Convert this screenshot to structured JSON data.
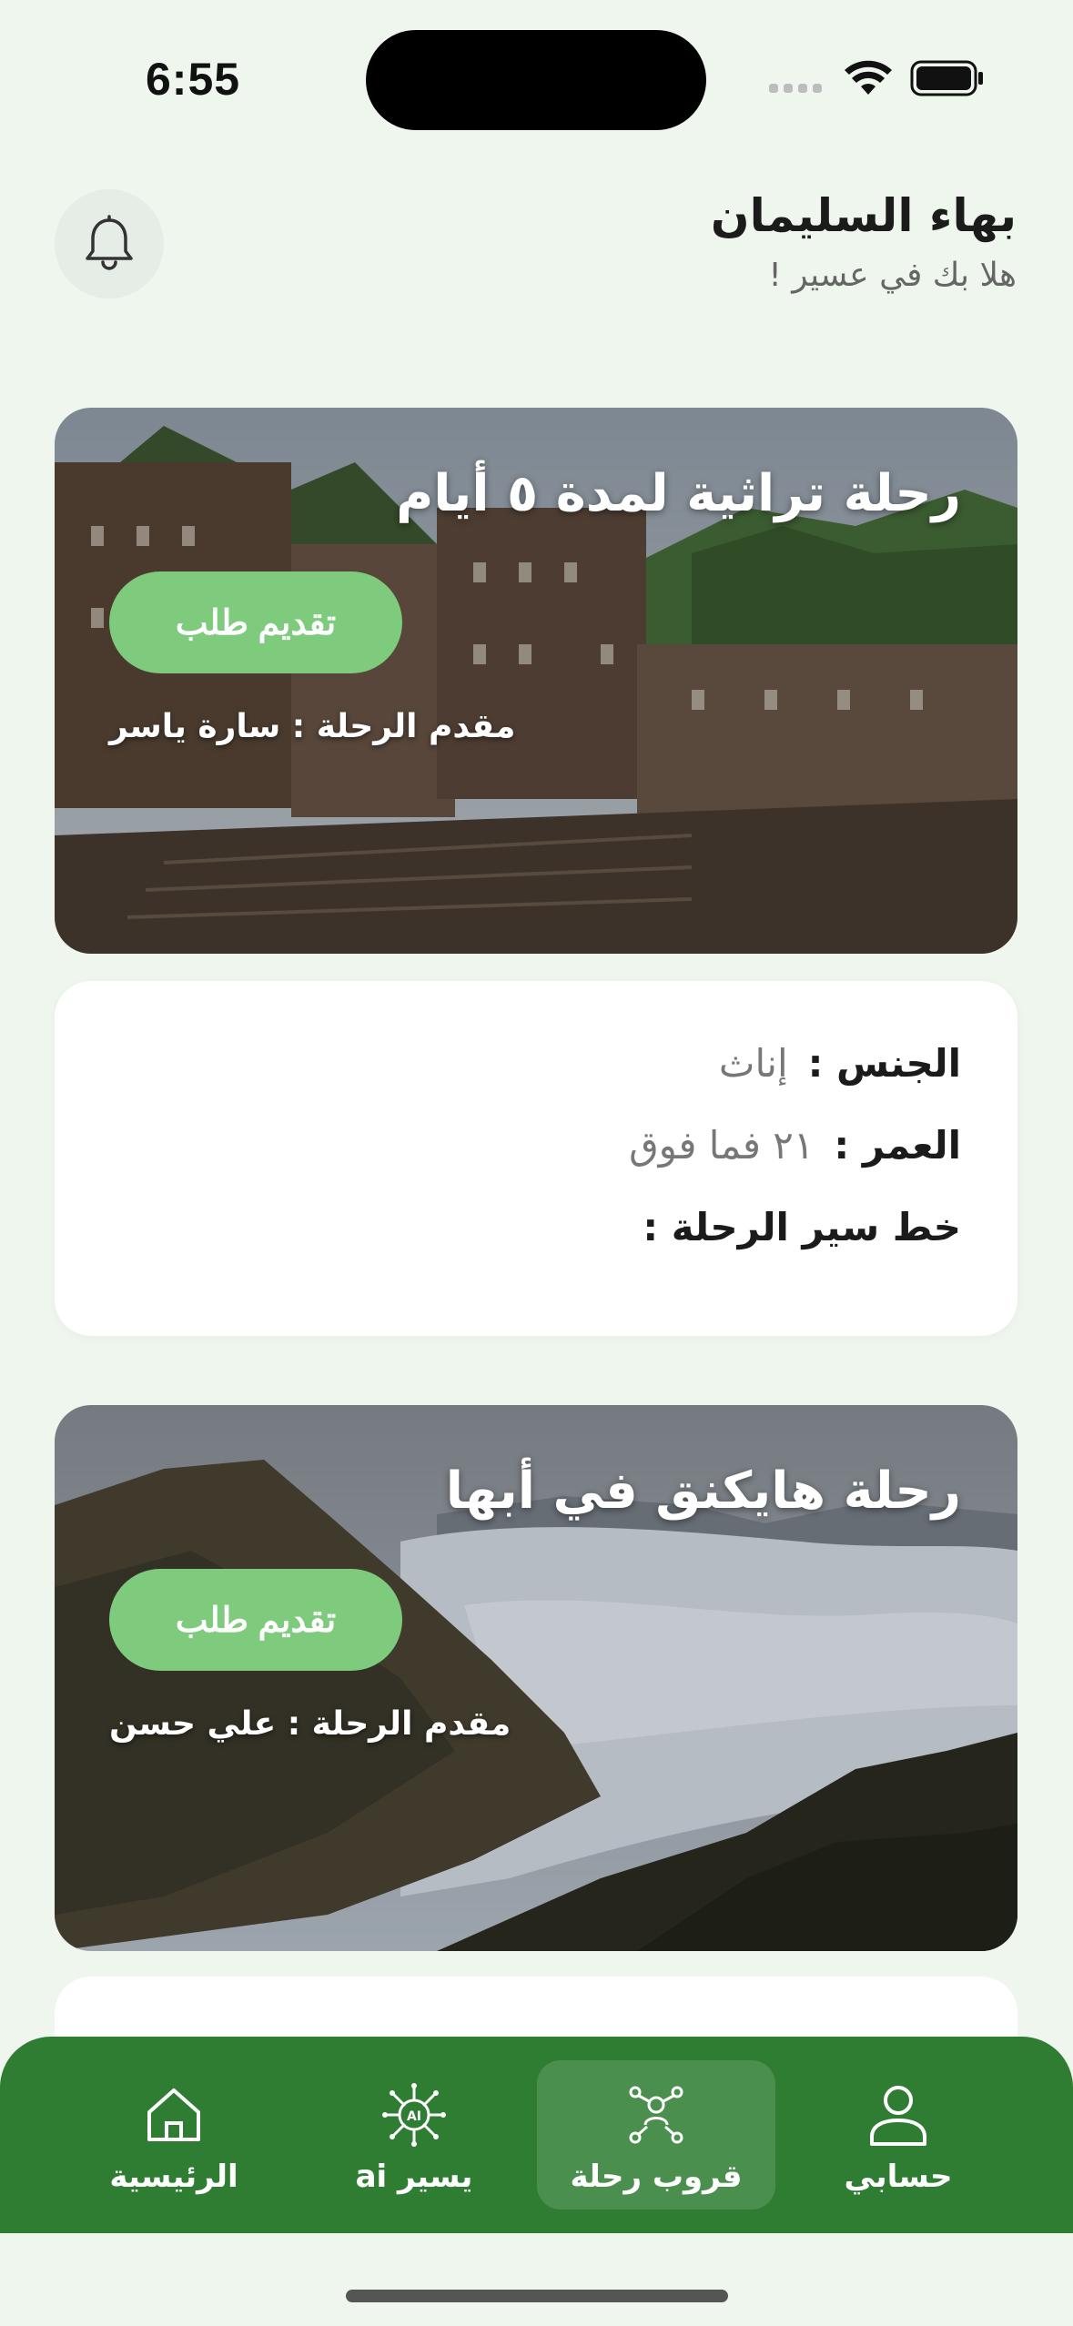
{
  "status_bar": {
    "time": "6:55"
  },
  "header": {
    "user_name": "بهاء السليمان",
    "greeting": "هلا بك في عسير !"
  },
  "trips": [
    {
      "title": "رحلة تراثية لمدة ٥ أيام",
      "apply_label": "تقديم طلب",
      "provider": "مقدم الرحلة : سارة ياسر"
    },
    {
      "title": "رحلة هايكنق في أبها",
      "apply_label": "تقديم طلب",
      "provider": "مقدم الرحلة : علي حسن"
    }
  ],
  "details": {
    "gender_label": "الجنس :",
    "gender_value": "إناث",
    "age_label": "العمر :",
    "age_value": "٢١ فما فوق",
    "itinerary_label": "خط سير الرحلة :"
  },
  "nav": [
    {
      "label": "الرئيسية",
      "icon": "home-icon"
    },
    {
      "label": "يسير ai",
      "icon": "ai-chip-icon"
    },
    {
      "label": "قروب رحلة",
      "icon": "group-icon"
    },
    {
      "label": "حسابي",
      "icon": "profile-icon"
    }
  ],
  "colors": {
    "background": "#eef6ee",
    "nav_green": "#2e7d32",
    "button_green": "#7ecb7d"
  }
}
